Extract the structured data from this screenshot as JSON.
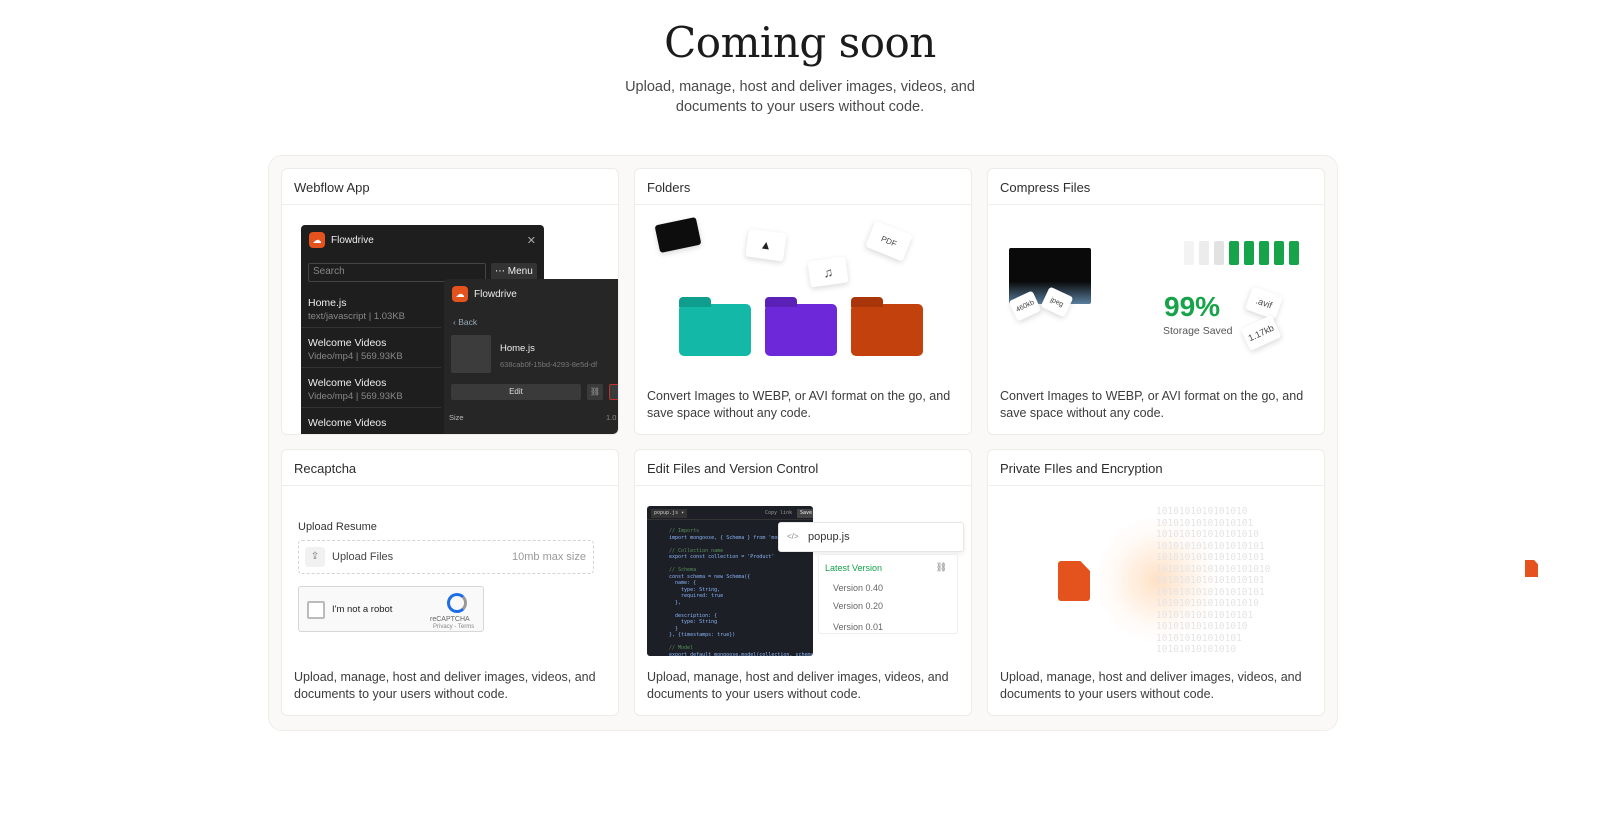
{
  "hero": {
    "title": "Coming soon",
    "subtitle": "Upload, manage, host and deliver images, videos, and documents to your users without code."
  },
  "cards": {
    "webflow": {
      "title": "Webflow App",
      "app_name": "Flowdrive",
      "search_placeholder": "Search",
      "menu_label": "⋯ Menu",
      "files": [
        {
          "name": "Home.js",
          "meta": "text/javascript | 1.03KB"
        },
        {
          "name": "Welcome Videos",
          "meta": "Video/mp4 | 569.93KB"
        },
        {
          "name": "Welcome Videos",
          "meta": "Video/mp4 | 569.93KB"
        },
        {
          "name": "Welcome Videos",
          "meta": ""
        }
      ],
      "detail": {
        "app_name": "Flowdrive",
        "back": "‹ Back",
        "file_name": "Home.js",
        "file_id": "638cab0f-15bd-4293-8e5d-df",
        "edit": "Edit",
        "size_label": "Size",
        "size_value": "1.0"
      }
    },
    "folders": {
      "title": "Folders",
      "tags": [
        "PDF",
        "♫",
        "▲"
      ],
      "description": "Convert Images to WEBP, or AVI format on the go, and save space without any code."
    },
    "compress": {
      "title": "Compress Files",
      "percent": "99%",
      "percent_label": "Storage Saved",
      "tags": [
        "460kb",
        "jpeg",
        ".avif",
        "1.17kb"
      ],
      "description": "Convert Images to WEBP, or AVI format on the go, and save space without any code."
    },
    "recaptcha": {
      "title": "Recaptcha",
      "upload_label": "Upload Resume",
      "upload_text": "Upload Files",
      "max_size": "10mb max size",
      "robot_text": "I'm not a robot",
      "brand": "reCAPTCHA",
      "privacy": "Privacy - Terms",
      "description": "Upload, manage, host and deliver images, videos, and documents to your users without code."
    },
    "edit": {
      "title": "Edit Files and Version Control",
      "tab": "popup.js ▾",
      "copy": "Copy link",
      "save": "Save",
      "popup_file": "popup.js",
      "latest": "Latest Version",
      "versions": [
        "Version 0.40",
        "Version 0.20",
        "Version 0.01"
      ],
      "description": "Upload, manage, host and deliver images, videos, and documents to your users without code."
    },
    "private": {
      "title": "Private FIles and Encryption",
      "description": "Upload, manage, host and deliver images, videos, and documents to your users without code."
    }
  },
  "colors": {
    "accent": "#e4531d",
    "success": "#16a34a",
    "folder_teal": "#14b8a6",
    "folder_purple": "#6d28d9",
    "folder_orange": "#c2410c"
  }
}
